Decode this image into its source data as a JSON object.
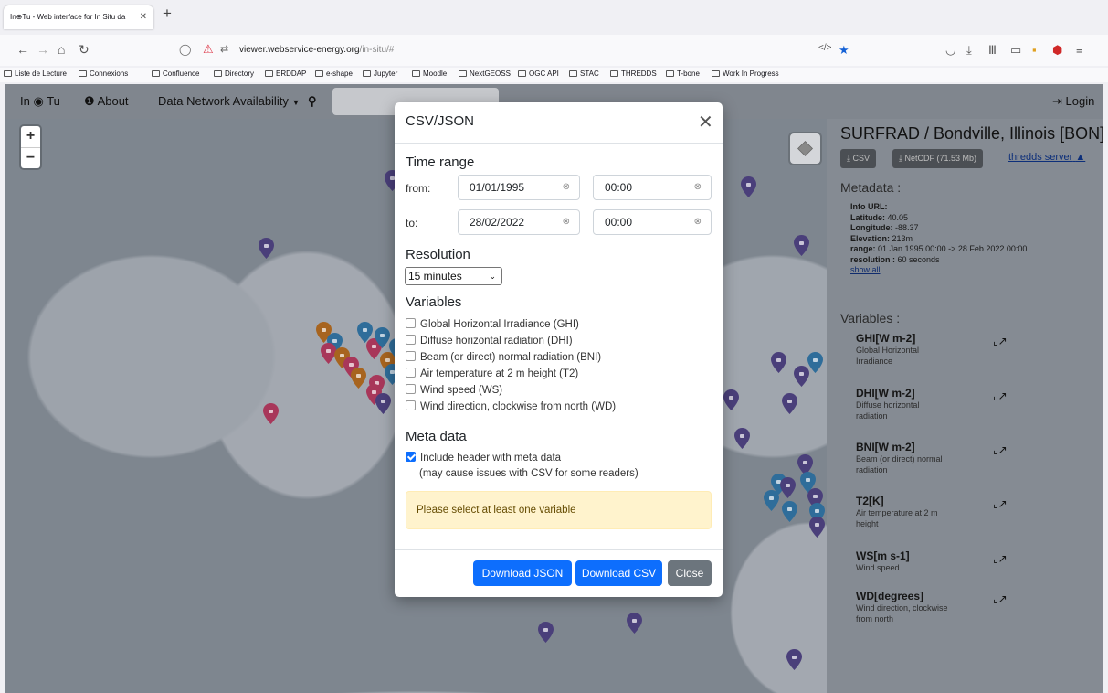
{
  "browser": {
    "tab_title": "In⊕Tu - Web interface for In Situ da",
    "url_domain": "viewer.webservice-energy.org",
    "url_path": "/in-situ/#",
    "bookmarks": [
      "Liste de Lecture",
      "Connexions",
      "Confluence",
      "Directory",
      "ERDDAP",
      "e-shape",
      "Jupyter",
      "Moodle",
      "NextGEOSS",
      "OGC API",
      "STAC",
      "THREDDS",
      "T-bone",
      "Work In Progress"
    ]
  },
  "appbar": {
    "brand_pre": "In",
    "brand_post": "Tu",
    "about": "About",
    "network": "Data Network Availability",
    "login": "Login"
  },
  "panel": {
    "title": "SURFRAD / Bondville, Illinois [BON]",
    "csv_btn": "CSV",
    "netcdf_btn": "NetCDF (71.53 Mb)",
    "thredds": "thredds server",
    "metadata_heading": "Metadata :",
    "info_url_label": "Info URL:",
    "latitude_label": "Latitude:",
    "latitude": "40.05",
    "longitude_label": "Longitude:",
    "longitude": "-88.37",
    "elevation_label": "Elevation:",
    "elevation": "213m",
    "range_label": "range:",
    "range": "01 Jan 1995 00:00 -> 28 Feb 2022 00:00",
    "resolution_label": "resolution :",
    "resolution": "60 seconds",
    "show_all": "show all",
    "variables_heading": "Variables :",
    "variables": [
      {
        "name": "GHI[W m-2]",
        "desc1": "Global Horizontal",
        "desc2": "Irradiance"
      },
      {
        "name": "DHI[W m-2]",
        "desc1": "Diffuse horizontal",
        "desc2": "radiation"
      },
      {
        "name": "BNI[W m-2]",
        "desc1": "Beam (or direct) normal",
        "desc2": "radiation"
      },
      {
        "name": "T2[K]",
        "desc1": "Air temperature at 2 m",
        "desc2": "height"
      },
      {
        "name": "WS[m s-1]",
        "desc1": "Wind speed",
        "desc2": ""
      },
      {
        "name": "WD[degrees]",
        "desc1": "Wind direction, clockwise",
        "desc2": "from north"
      }
    ]
  },
  "modal": {
    "title": "CSV/JSON",
    "time_range": "Time range",
    "from_label": "from:",
    "from_date": "01/01/1995",
    "from_time": "00:00",
    "to_label": "to:",
    "to_date": "28/02/2022",
    "to_time": "00:00",
    "resolution_heading": "Resolution",
    "resolution_value": "15 minutes",
    "variables_heading": "Variables",
    "variables": [
      "Global Horizontal Irradiance (GHI)",
      "Diffuse horizontal radiation (DHI)",
      "Beam (or direct) normal radiation (BNI)",
      "Air temperature at 2 m height (T2)",
      "Wind speed (WS)",
      "Wind direction, clockwise from north (WD)"
    ],
    "meta_heading": "Meta data",
    "meta_checkbox": "Include header with meta data",
    "meta_checked": true,
    "meta_note": "(may cause issues with CSV for some readers)",
    "warning": "Please select at least one variable",
    "btn_json": "Download JSON",
    "btn_csv": "Download CSV",
    "btn_close": "Close"
  },
  "colors": {
    "primary": "#0d6efd",
    "secondary": "#6c757d",
    "marker_purple": "#4a3f7a",
    "marker_blue": "#2f6d9a",
    "marker_pink": "#a8375a",
    "marker_orange": "#a7641f"
  }
}
